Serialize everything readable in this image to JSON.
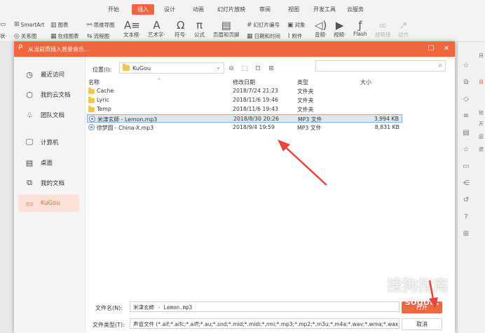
{
  "ribbon": {
    "tabs": [
      "开始",
      "插入",
      "设计",
      "动画",
      "幻灯片放映",
      "审阅",
      "视图",
      "开发工具",
      "云服务"
    ],
    "active_tab": "插入",
    "small_items": {
      "smartart": "SmartArt",
      "chart": "图表",
      "mindmap": "思维导图",
      "relation": "关系图",
      "online_chart": "在线图表",
      "flowchart": "流程图",
      "shape_partial": "状·"
    },
    "big_items": {
      "textbox": "文本框·",
      "wordart": "艺术字·",
      "symbol": "符号·",
      "formula": "公式",
      "header_footer": "页眉和页脚",
      "slide_number": "幻灯片编号",
      "object": "对象",
      "datetime": "日期和时间",
      "attachment": "附件",
      "audio": "音频·",
      "video": "视频·",
      "flash": "Flash",
      "hyperlink": "超链接",
      "action": "动作"
    }
  },
  "dialog": {
    "title": "从当前页插入背景音乐...",
    "nav": [
      {
        "label": "最近访问",
        "icon": "clock"
      },
      {
        "label": "我的云文档",
        "icon": "cube"
      },
      {
        "label": "团队文档",
        "icon": "team"
      },
      {
        "label": "计算机",
        "icon": "monitor"
      },
      {
        "label": "桌面",
        "icon": "desktop"
      },
      {
        "label": "我的文档",
        "icon": "documents"
      },
      {
        "label": "KuGou",
        "icon": "folder"
      }
    ],
    "active_nav": "KuGou",
    "location_label": "位置(I):",
    "location_value": "KuGou",
    "columns": {
      "name": "名称",
      "modified": "修改日期",
      "type": "类型",
      "size": "大小"
    },
    "files": [
      {
        "name": "Cache",
        "modified": "2018/7/24 21:23",
        "type": "文件夹",
        "size": "",
        "kind": "folder",
        "selected": false
      },
      {
        "name": "Lyric",
        "modified": "2018/11/6 19:46",
        "type": "文件夹",
        "size": "",
        "kind": "folder",
        "selected": false
      },
      {
        "name": "Temp",
        "modified": "2018/11/6 19:43",
        "type": "文件夹",
        "size": "",
        "kind": "folder",
        "selected": false
      },
      {
        "name": "米津玄師 - Lemon.mp3",
        "modified": "2018/8/30 20:26",
        "type": "MP3 文件",
        "size": "3,994 KB",
        "kind": "mp3",
        "selected": true
      },
      {
        "name": "徐梦圆 - China-X.mp3",
        "modified": "2018/9/4 19:59",
        "type": "MP3 文件",
        "size": "8,831 KB",
        "kind": "mp3",
        "selected": false
      }
    ],
    "filename_label": "文件名(N):",
    "filename_value": "米津玄師 - Lemon.mp3",
    "filetype_label": "文件类型(T):",
    "filetype_value": "声音文件 (*.aif;*.aifc;*.aiff;*.au;*.snd;*.mid;*.midi;*.rmi;*.mp3;*.mp2;*.m3u;*.m4a;*.wav;*.wma;*.wax)",
    "open_label": "打开",
    "cancel_label": "取消"
  },
  "side_pane": {
    "labels": [
      "自",
      "自",
      "修",
      "开",
      "庭",
      "遮"
    ]
  },
  "watermark": {
    "text": "搜狗指南",
    "url": "sogou."
  },
  "colors": {
    "accent": "#f0663e",
    "selection": "#d9e9fb",
    "annotation_arrow": "#e8453c"
  }
}
